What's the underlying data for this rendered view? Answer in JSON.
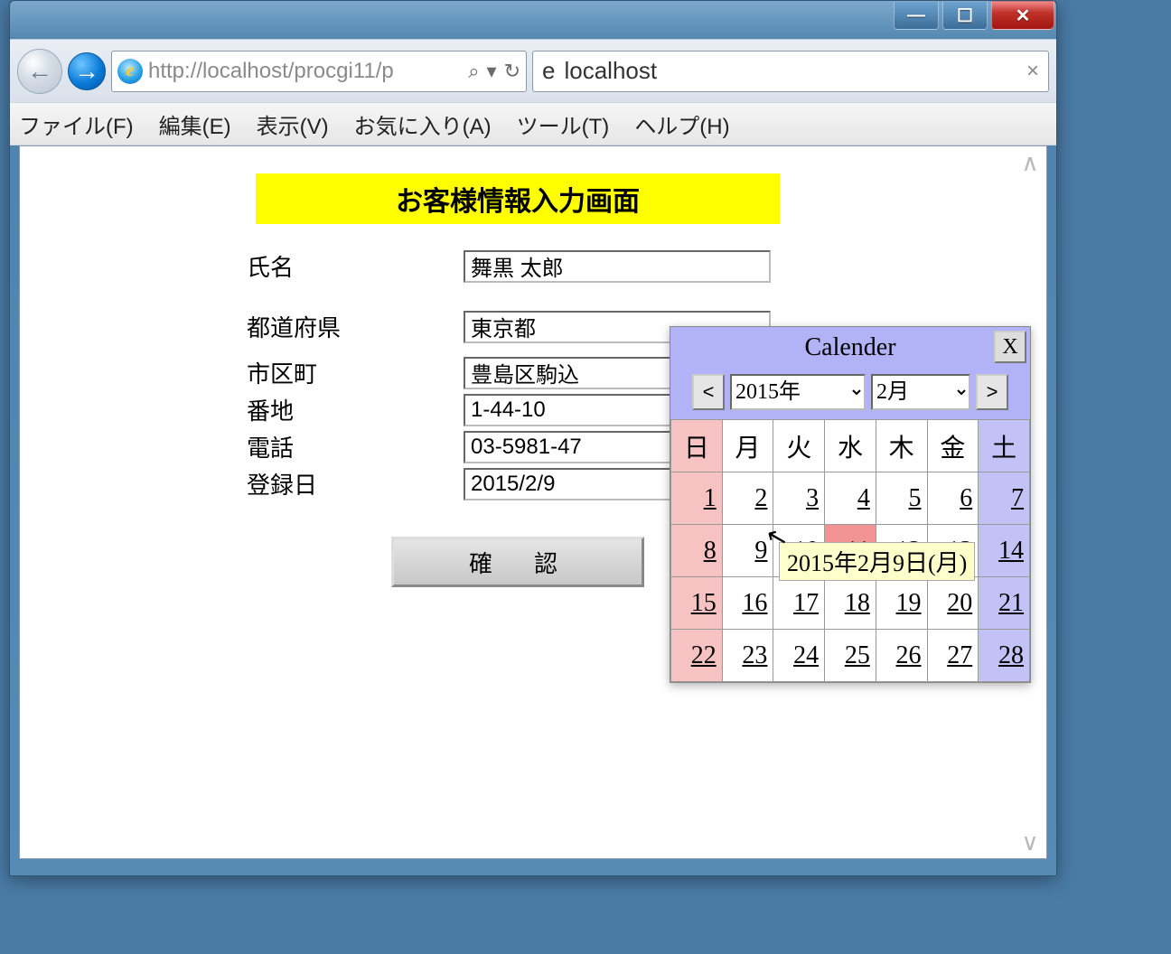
{
  "window": {
    "min_glyph": "—",
    "max_glyph": "☐",
    "close_glyph": "✕"
  },
  "address_bar": {
    "url": "http://localhost/procgi11/p",
    "search_glyph": "⌕",
    "dropdown_glyph": "▾",
    "refresh_glyph": "↻"
  },
  "tab": {
    "title": "localhost",
    "close_glyph": "×"
  },
  "menu": {
    "file": "ファイル(F)",
    "edit": "編集(E)",
    "view": "表示(V)",
    "fav": "お気に入り(A)",
    "tool": "ツール(T)",
    "help": "ヘルプ(H)"
  },
  "page": {
    "title": "お客様情報入力画面",
    "labels": {
      "name": "氏名",
      "pref": "都道府県",
      "city": "市区町",
      "addr": "番地",
      "tel": "電話",
      "regdate": "登録日"
    },
    "values": {
      "name": "舞黒 太郎",
      "pref": "東京都",
      "city": "豊島区駒込",
      "addr": "1-44-10",
      "tel": "03-5981-47",
      "regdate": "2015/2/9"
    },
    "confirm": "確　認"
  },
  "calendar": {
    "title": "Calender",
    "close": "X",
    "prev": "<",
    "next": ">",
    "year": "2015年",
    "month": "2月",
    "dow": {
      "sun": "日",
      "mon": "月",
      "tue": "火",
      "wed": "水",
      "thu": "木",
      "fri": "金",
      "sat": "土"
    },
    "weeks": [
      [
        1,
        2,
        3,
        4,
        5,
        6,
        7
      ],
      [
        8,
        9,
        10,
        11,
        12,
        13,
        14
      ],
      [
        15,
        16,
        17,
        18,
        19,
        20,
        21
      ],
      [
        22,
        23,
        24,
        25,
        26,
        27,
        28
      ]
    ],
    "holiday": 11,
    "tooltip": "2015年2月9日(月)"
  },
  "scroll": {
    "up": "∧",
    "down": "∨"
  }
}
